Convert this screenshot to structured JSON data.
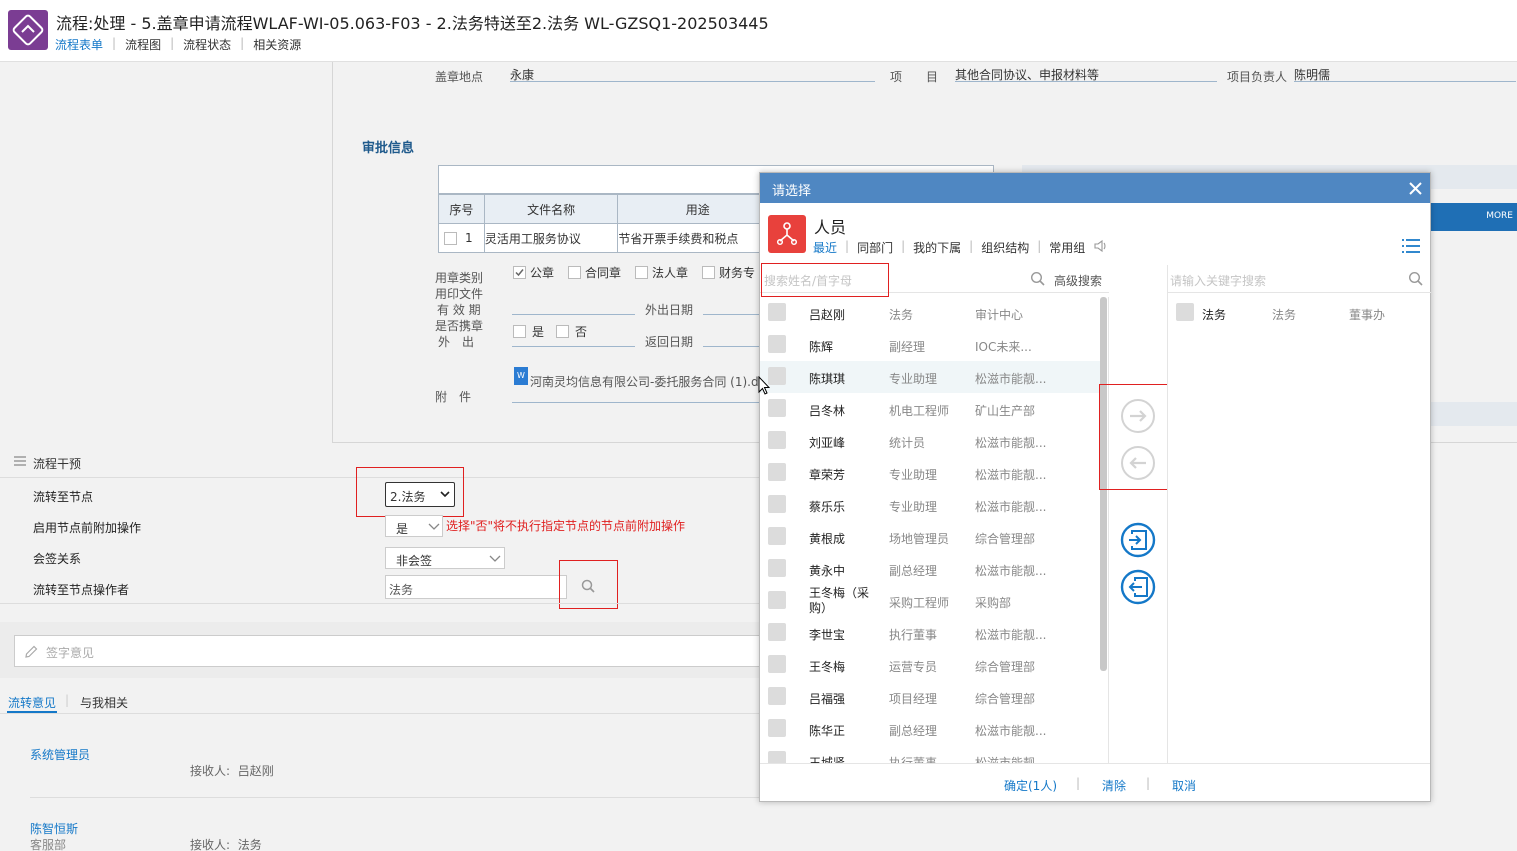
{
  "header": {
    "title": "流程:处理 - 5.盖章申请流程WLAF-WI-05.063-F03 - 2.法务特送至2.法务 WL-GZSQ1-202503445",
    "tabs": [
      "流程表单",
      "流程图",
      "流程状态",
      "相关资源"
    ],
    "active_tab": "流程表单"
  },
  "form": {
    "seal_location_label": "盖章地点",
    "seal_location_value": "永康",
    "item_label": "项　　目",
    "item_value": "其他合同协议、申报材料等",
    "project_owner_label": "项目负责人",
    "project_owner_value": "陈明儒",
    "approval_section_title": "审批信息",
    "table_headers": [
      "序号",
      "文件名称",
      "用途"
    ],
    "table_rows": [
      {
        "seq": "1",
        "file": "灵活用工服务协议",
        "usage": "节省开票手续费和税点"
      }
    ],
    "seal_type_label": "用章类别",
    "seal_types": [
      {
        "label": "公章",
        "checked": true
      },
      {
        "label": "合同章",
        "checked": false
      },
      {
        "label": "法人章",
        "checked": false
      },
      {
        "label": "财务专",
        "checked": false
      }
    ],
    "seal_doc_label": "用印文件",
    "validity_label": "有 效 期",
    "carry_label": "是否携章",
    "out_label": "外　出",
    "yes_label": "是",
    "no_label": "否",
    "out_date_label": "外出日期",
    "return_date_label": "返回日期",
    "attachment_label": "附　件",
    "attachment_file": "河南灵均信息有限公司-委托服务合同 (1).d"
  },
  "background_right": {
    "more_label": "MORE"
  },
  "process": {
    "section_title": "流程干预",
    "node_label": "流转至节点",
    "node_value": "2.法务",
    "pre_op_label": "启用节点前附加操作",
    "pre_op_value": "是",
    "pre_op_hint": "选择\"否\"将不执行指定节点的节点前附加操作",
    "countersign_label": "会签关系",
    "countersign_value": "非会签",
    "operator_label": "流转至节点操作者",
    "operator_value": "法务"
  },
  "comments": {
    "sign_placeholder": "签字意见",
    "tabs": [
      "流转意见",
      "与我相关"
    ],
    "active_tab": "流转意见",
    "entries": [
      {
        "name": "系统管理员",
        "dept": "",
        "receiver_label": "接收人:",
        "receiver": "吕赵刚"
      },
      {
        "name": "陈智恒斯",
        "dept": "客服部",
        "receiver_label": "接收人:",
        "receiver": "法务"
      }
    ]
  },
  "modal": {
    "title": "请选择",
    "heading": "人员",
    "tabs": [
      "最近",
      "同部门",
      "我的下属",
      "组织结构",
      "常用组"
    ],
    "active_tab": "最近",
    "search_placeholder": "搜索姓名/首字母",
    "advanced_search": "高级搜索",
    "right_search_placeholder": "请输入关键字搜索",
    "people": [
      {
        "name": "吕赵刚",
        "title": "法务",
        "dept": "审计中心"
      },
      {
        "name": "陈辉",
        "title": "副经理",
        "dept": "IOC未来..."
      },
      {
        "name": "陈琪琪",
        "title": "专业助理",
        "dept": "松滋市能靓..."
      },
      {
        "name": "吕冬林",
        "title": "机电工程师",
        "dept": "矿山生产部"
      },
      {
        "name": "刘亚峰",
        "title": "统计员",
        "dept": "松滋市能靓..."
      },
      {
        "name": "章荣芳",
        "title": "专业助理",
        "dept": "松滋市能靓..."
      },
      {
        "name": "蔡乐乐",
        "title": "专业助理",
        "dept": "松滋市能靓..."
      },
      {
        "name": "黄根成",
        "title": "场地管理员",
        "dept": "综合管理部"
      },
      {
        "name": "黄永中",
        "title": "副总经理",
        "dept": "松滋市能靓..."
      },
      {
        "name": "王冬梅（采购）",
        "title": "采购工程师",
        "dept": "采购部"
      },
      {
        "name": "李世宝",
        "title": "执行董事",
        "dept": "松滋市能靓..."
      },
      {
        "name": "王冬梅",
        "title": "运营专员",
        "dept": "综合管理部"
      },
      {
        "name": "吕福强",
        "title": "项目经理",
        "dept": "综合管理部"
      },
      {
        "name": "陈华正",
        "title": "副总经理",
        "dept": "松滋市能靓..."
      },
      {
        "name": "王城贤",
        "title": "执行董事",
        "dept": "松滋市能靓..."
      }
    ],
    "selected": [
      {
        "name": "法务",
        "title": "法务",
        "dept": "董事办"
      }
    ],
    "confirm_label": "确定(1人)",
    "clear_label": "清除",
    "cancel_label": "取消"
  },
  "colors": {
    "accent": "#1478c8",
    "modal_header": "#4f87c2",
    "highlight_box": "#e02020",
    "logo": "#7b3d93",
    "person_icon": "#e8413c"
  }
}
